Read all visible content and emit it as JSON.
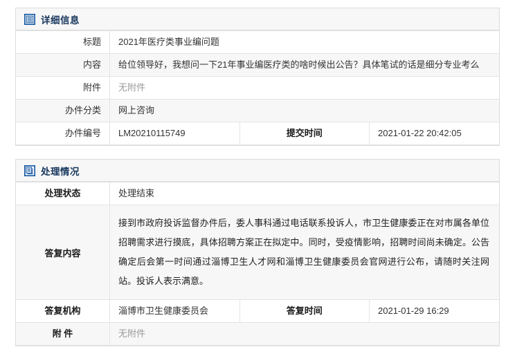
{
  "sections": [
    {
      "id": "detail",
      "icon": "document-lines-icon",
      "title": "详细信息",
      "rows": [
        {
          "label": "标题",
          "value": "2021年医疗类事业编问题"
        },
        {
          "label": "内容",
          "value": "给位领导好，我想问一下21年事业编医疗类的啥时候出公告？具体笔试的话是细分专业考么"
        },
        {
          "label": "附件",
          "value": "无附件"
        },
        {
          "label": "办件分类",
          "value": "网上咨询"
        },
        {
          "label": "办件编号",
          "value": "LM20210115749",
          "label2": "提交时间",
          "value2": "2021-01-22 20:42:05"
        }
      ]
    },
    {
      "id": "process",
      "icon": "reply-stack-icon",
      "title": "处理情况",
      "rows": [
        {
          "label": "处理状态",
          "value": "处理结束"
        },
        {
          "label": "答复内容",
          "value": "接到市政府投诉监督办件后，委人事科通过电话联系投诉人，市卫生健康委正在对市属各单位招聘需求进行摸底，具体招聘方案正在拟定中。同时，受疫情影响，招聘时间尚未确定。公告确定后会第一时间通过淄博卫生人才网和淄博卫生健康委员会官网进行公布，请随时关注网站。投诉人表示满意。"
        },
        {
          "label": "答复机构",
          "value": "淄博市卫生健康委员会",
          "label2": "答复时间",
          "value2": "2021-01-29 16:29"
        },
        {
          "label": "附 件",
          "value": "无附件"
        }
      ]
    }
  ],
  "colors": {
    "title": "#17365d",
    "icon_blue": "#1455a0",
    "border": "#e4e4e4",
    "panel_border": "#dcdcdc",
    "header_bg": "#f7f7f7",
    "row_alt_bg": "#f7f7f7",
    "muted_text": "#999999"
  }
}
